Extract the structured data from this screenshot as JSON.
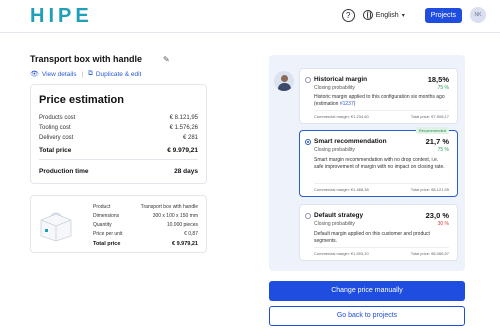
{
  "header": {
    "logo": "HIPE",
    "help_icon": "?",
    "language": "English",
    "projects_label": "Projects",
    "avatar_initials": "NK"
  },
  "product": {
    "title": "Transport box with handle",
    "view_details": "View details",
    "duplicate_edit": "Duplicate & edit"
  },
  "price_estimation": {
    "title": "Price estimation",
    "rows": [
      {
        "label": "Products cost",
        "value": "€ 8.121,95"
      },
      {
        "label": "Tooling cost",
        "value": "€ 1.576,26"
      },
      {
        "label": "Delivery cost",
        "value": "€ 281"
      }
    ],
    "total_label": "Total price",
    "total_value": "€ 9.979,21",
    "production_label": "Production time",
    "production_value": "28 days"
  },
  "product_summary": {
    "rows": [
      {
        "label": "Product",
        "value": "Transport box with handle"
      },
      {
        "label": "Dimensions",
        "value": "300 x 100 x 150 mm"
      },
      {
        "label": "Quantity",
        "value": "10.000 pieces"
      },
      {
        "label": "Price per unit",
        "value": "€ 0,87"
      }
    ],
    "total_label": "Total price",
    "total_value": "€ 9.979,21"
  },
  "options": [
    {
      "name": "Historical margin",
      "pct": "18,5%",
      "sub": "Closing probability",
      "prob": "75 %",
      "desc_pre": "Historic margin applied to this configuration six months ago (estimation ",
      "desc_link": "#1237",
      "desc_post": ")",
      "foot_left": "Commercial margin: €1.234,60",
      "foot_right": "Total price: €7.908,17"
    },
    {
      "name": "Smart recommendation",
      "badge": "Recommended",
      "pct": "21,7 %",
      "sub": "Closing probability",
      "prob": "75 %",
      "desc": "Smart margin recommendation with no drop context, i.e. safe improvement of margin with no impact on closing rate.",
      "foot_left": "Commercial margin: €1.468,38",
      "foot_right": "Total price: €8.121,95"
    },
    {
      "name": "Default strategy",
      "pct": "23,0 %",
      "sub": "Closing probability",
      "prob": "30 %",
      "desc": "Default margin applied on this customer and product segments.",
      "foot_left": "Commercial margin: €1.593,10",
      "foot_right": "Total price: €8.066,97"
    }
  ],
  "actions": {
    "change_price": "Change price manually",
    "back": "Go back to projects"
  },
  "colors": {
    "accent": "#1e4de0",
    "logo": "#1f9fb8",
    "prob_green": "#2e9d57",
    "prob_red": "#d63a3a"
  }
}
